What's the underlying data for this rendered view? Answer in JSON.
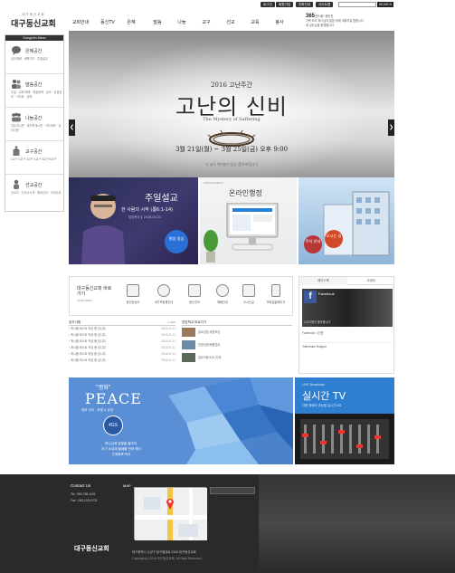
{
  "utility": {
    "items": [
      "로그인",
      "회원가입",
      "전화안내",
      "사이트맵"
    ],
    "search_placeholder": "",
    "search_button": "SEARCH"
  },
  "logo": {
    "small": "대구동신교회",
    "big": "대구동신교회"
  },
  "nav": {
    "items": [
      "교회안내",
      "동신TV",
      "은혜",
      "말씀",
      "나눔",
      "교구",
      "선교",
      "교육",
      "봉사"
    ]
  },
  "welcome": {
    "headline": "365",
    "line1": "한사랑, 한비전",
    "line2": "가족 모두 하나님의 말씀 위에 세워지길 원합니다",
    "line3": "새 성도님을 환영합니다"
  },
  "sidebar": {
    "head": "Dongshin Menu",
    "sections": [
      {
        "title": "은혜공간",
        "links": [
          "금요예배",
          "새벽기도",
          "주일설교"
        ]
      },
      {
        "title": "말씀공간",
        "links": [
          "주일",
          "교회 예배",
          "특별새벽",
          "금요",
          "성경공부",
          "기도회",
          "강좌"
        ]
      },
      {
        "title": "나눔공간",
        "links": [
          "자유게시판",
          "새가족게시판",
          "기도제목",
          "공지사항"
        ]
      },
      {
        "title": "교구공간",
        "links": [
          "1교구",
          "2교구",
          "3교구",
          "4교구",
          "5교구",
          "6교구"
        ]
      },
      {
        "title": "선교공간",
        "links": [
          "선교지",
          "선교사소개",
          "해외선교",
          "국내선교"
        ]
      }
    ]
  },
  "hero": {
    "subtitle": "2016 고난주간",
    "title": "고난의 신비",
    "english": "The Mystery of Suffering",
    "dates": "3월 21일(월) ~ 3월 25일(금) 오후 9:00",
    "info": "※ 성도 여러분의 많은 참여 바랍니다",
    "prev": "❮",
    "next": "❯"
  },
  "panel1": {
    "title": "주일설교",
    "sermon": "한 사람의 시작 (롬6:1-14)",
    "meta": "담임목사 ┃ 2016.02.21",
    "circle": "말씀 영상"
  },
  "panel2": {
    "title": "온라인행정",
    "caption": "Administration"
  },
  "panel3": {
    "circle1": "주차 안내",
    "circle2": "오시는 길"
  },
  "quick": {
    "title": "대구동신교회 바로가기",
    "sub": "Quick Menu",
    "items": [
      "동신방송국",
      "새가족등록안내",
      "동신주보",
      "예배안내",
      "오시는길",
      "모바일홈페이지"
    ]
  },
  "fb": {
    "tabs": [
      "페이스북",
      "트위터"
    ],
    "page_name": "Facebook",
    "post1": "2,372명이 좋아합니다",
    "post2": "Facebook 시간표",
    "post3": "Tottenham Hotspur"
  },
  "boards": {
    "left": {
      "title": "공지사항",
      "more": "Login",
      "rows": [
        {
          "t": "게시물 테스트 작성 중 입니다.",
          "d": "2016.01.11"
        },
        {
          "t": "게시물 테스트 작성 중 입니다.",
          "d": "2016.01.11"
        },
        {
          "t": "게시물 테스트 작성 중 입니다.",
          "d": "2016.01.11"
        },
        {
          "t": "게시물 테스트 작성 중 입니다.",
          "d": "2016.01.11"
        },
        {
          "t": "게시물 테스트 작성 중 입니다.",
          "d": "2016.01.11"
        },
        {
          "t": "게시물 테스트 작성 중 입니다.",
          "d": "2016.01.11"
        }
      ]
    },
    "right": {
      "title": "양업학교 바로가기",
      "rows": [
        "일요양업 위원모임",
        "전방성방/베풂업로",
        "일요이용/ICE 여 와"
      ]
    }
  },
  "peace": {
    "head": "\"평화\"",
    "word": "PEACE",
    "line": "평화 정의 - 화해 & 상생",
    "badge": "4GS",
    "desc1": "하나님께 영광을 돌리자.",
    "desc2": "자기 소유에 둘째를 만져 헤서",
    "desc3": "관계회복 하자"
  },
  "live": {
    "badge": "LIVE Broadcast",
    "title": "실시간 TV",
    "sub": "각종 예배와 영상을 실시간으로"
  },
  "footer": {
    "contact": "Contact Us",
    "map": "MAP",
    "tel": "Tel : 053.756.1191",
    "fax": "Fax : 053.215.4703",
    "address": "대구광역시 수성구 달구벌대로 2345 대구동신교회",
    "copyright": "Copyright(c) 2016 대구동신교회. All Right Reserved.",
    "logo": "대구동신교회"
  }
}
